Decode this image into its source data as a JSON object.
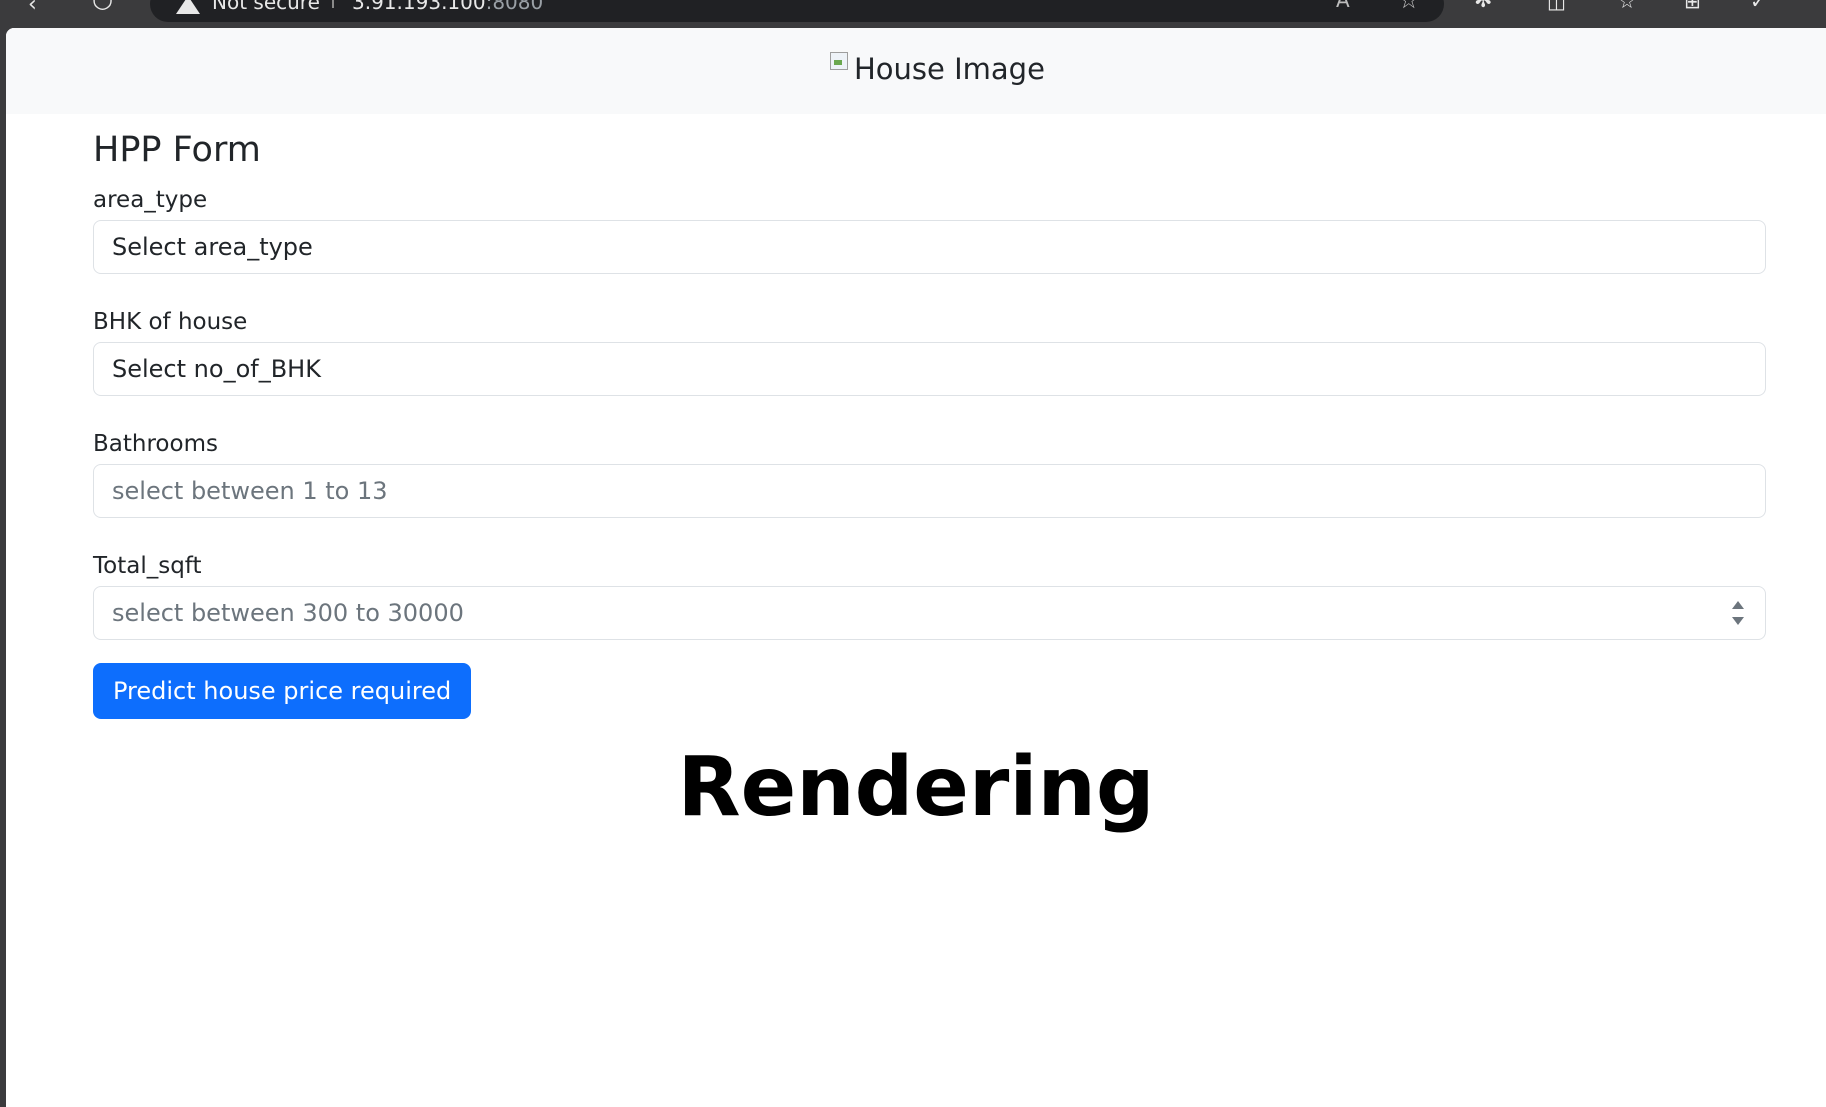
{
  "browser": {
    "security_text": "Not secure",
    "url_host": "3.91.193.100",
    "url_port": ":8080"
  },
  "navbar": {
    "image_alt": "House Image"
  },
  "form": {
    "title": "HPP Form",
    "fields": [
      {
        "label": "area_type",
        "value": "Select area_type",
        "placeholder": ""
      },
      {
        "label": "BHK of house",
        "value": "Select no_of_BHK",
        "placeholder": ""
      },
      {
        "label": "Bathrooms",
        "value": "",
        "placeholder": "select between 1 to 13"
      },
      {
        "label": "Total_sqft",
        "value": "",
        "placeholder": "select between 300 to 30000"
      }
    ],
    "submit_label": "Predict house price required"
  },
  "result": {
    "text": "Rendering"
  }
}
